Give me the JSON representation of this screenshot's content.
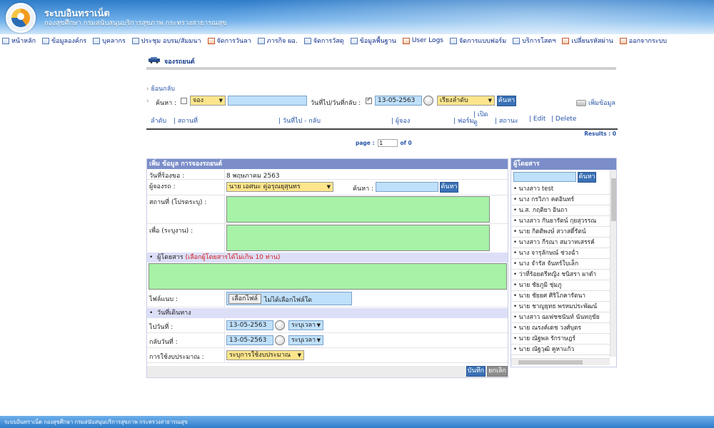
{
  "header": {
    "title": "ระบบอินทราเน็ต",
    "subtitle": "กองสุขศึกษา กรมสนับสนุนบริการสุขภาพ กระทรวงสาธารณสุข"
  },
  "menu": [
    {
      "label": "หน้าหลัก",
      "icon": "home-icon"
    },
    {
      "label": "ข้อมูลองค์กร",
      "icon": "organization-icon"
    },
    {
      "label": "บุคลากร",
      "icon": "people-icon"
    },
    {
      "label": "ประชุม อบรม/สัมมนา",
      "icon": "meeting-icon"
    },
    {
      "label": "จัดการวันลา",
      "icon": "leave-icon"
    },
    {
      "label": "ภารกิจ ผอ.",
      "icon": "calendar-icon"
    },
    {
      "label": "จัดการวัสดุ",
      "icon": "supplies-icon"
    },
    {
      "label": "ข้อมูลพื้นฐาน",
      "icon": "database-icon"
    },
    {
      "label": "User Logs",
      "icon": "logs-icon"
    },
    {
      "label": "จัดการแบบฟอร์ม",
      "icon": "form-icon"
    },
    {
      "label": "บริการโสตฯ",
      "icon": "media-icon"
    },
    {
      "label": "เปลี่ยนรหัสผ่าน",
      "icon": "password-icon"
    },
    {
      "label": "ออกจากระบบ",
      "icon": "logout-icon"
    }
  ],
  "page": {
    "title": "จองรถยนต์",
    "back": "ย้อนกลับ"
  },
  "search": {
    "label": "ค้นหา :",
    "type_select": "จอง",
    "keyword": "",
    "date_label": "วันที่ไป/วันที่กลับ :",
    "date_checked": true,
    "date": "13-05-2563",
    "sort_select": "เรียงลำดับ",
    "search_button": "ค้นหา",
    "add_label": "เพิ่มข้อมูล"
  },
  "columns": [
    "ลำดับ",
    "| สถานที่",
    "| วันที่ไป - กลับ",
    "| ผู้จอง",
    "| ฟอร์ม",
    "| เปิด ดู",
    "| สถานะ",
    "| Edit",
    "| Delete"
  ],
  "results": "Results : 0",
  "pager": {
    "label": "page :",
    "value": "1",
    "of": "of 0"
  },
  "form": {
    "title": "เพิ่ม ข้อมูล การจองรถยนต์",
    "request_date_label": "วันที่ร้องขอ :",
    "request_date": "8 พฤษภาคม 2563",
    "booker_label": "ผู้จองรถ :",
    "booker_select": "นาย เอศนะ คู่อรุณยุสุนทร",
    "booker_search_label": "ค้นหา :",
    "booker_search_button": "ค้นหา",
    "place_label": "สถานที่ (โปรดระบุ) :",
    "purpose_label": "เพื่อ (ระบุงาน) :",
    "passengers_label": "ผู้โดยสาร",
    "passengers_note": "(เลือกผู้โดยสารได้ไม่เกิน 10 ท่าน)",
    "attachment_label": "ไฟล์แนบ :",
    "choose_file": "เลือกไฟล์",
    "no_file": "ไม่ได้เลือกไฟล์ใด",
    "travel_date_head": "วันที่เดินทาง",
    "depart_label": "ไปวันที่ :",
    "depart_date": "13-05-2563",
    "depart_time": "ระบุเวลา",
    "return_label": "กลับวันที่ :",
    "return_date": "13-05-2563",
    "return_time": "ระบุเวลา",
    "budget_label": "การใช้งบประมาณ :",
    "budget_select": "ระบุการใช้งบประมาณ",
    "save_button": "บันทึก",
    "cancel_button": "ยกเลิก"
  },
  "passengers_panel": {
    "title": "ผู้โดยสาร",
    "search_button": "ค้นหา",
    "list": [
      "นางสาว test",
      "นาง กรวิภา คตอินทร์",
      "น.ส. กฤติยา อินถา",
      "นางสาว กันยารัตน์ กุยสุวรรณ",
      "นาย กิตติพงษ์ สวาสดิ์รัตน์",
      "นางสาว กีรณา สมวาทเสรรค์",
      "นาง จารุลักษณ์ ช่วงฉ่ำ",
      "นาง จำรัส จันทร์ใบเล็ก",
      "ว่าที่ร้อยตรีหญิง ชนิสรา ผาดำ",
      "นาย ชัยภูมิ ชุ่มภู",
      "นาย ชัยยศ ศิริโภคารัตนา",
      "นาย ชาญยุทธ พรหมประพัฒน์",
      "นางสาว ฌเฟชชนันท์ นันทฤขัย",
      "นาย ณรงค์เดช วงศ์บุตร",
      "นาย ณัฐพล รักราษฎร์",
      "นาย ณัฐวุฒิ คูหาแก้ว"
    ]
  },
  "footer": "ระบบอินทราเน็ต กองสุขศึกษา กรมสนับสนุนบริการสุขภาพ กระทรวงสาธารณสุข"
}
